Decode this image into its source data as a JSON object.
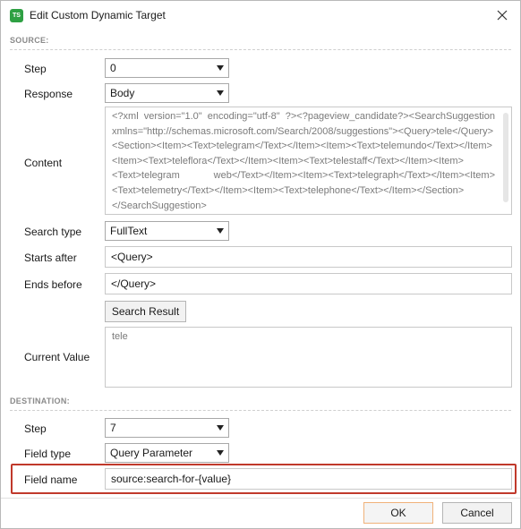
{
  "window": {
    "title": "Edit Custom Dynamic Target",
    "icon_text": "TS"
  },
  "source": {
    "section_label": "SOURCE:",
    "step": {
      "label": "Step",
      "value": "0"
    },
    "response": {
      "label": "Response",
      "value": "Body"
    },
    "content": {
      "label": "Content",
      "value": "<?xml version=\"1.0\" encoding=\"utf-8\" ?><?pageview_candidate?><SearchSuggestion xmlns=\"http://schemas.microsoft.com/Search/2008/suggestions\"><Query>tele</Query><Section><Item><Text>telegram</Text></Item><Item><Text>telemundo</Text></Item><Item><Text>teleflora</Text></Item><Item><Text>telestaff</Text></Item><Item><Text>telegram web</Text></Item><Item><Text>telegraph</Text></Item><Item><Text>telemetry</Text></Item><Item><Text>telephone</Text></Item></Section></SearchSuggestion>"
    },
    "search_type": {
      "label": "Search type",
      "value": "FullText"
    },
    "starts_after": {
      "label": "Starts after",
      "value": "<Query>"
    },
    "ends_before": {
      "label": "Ends before",
      "value": "</Query>"
    },
    "search_result_button": "Search Result",
    "current_value": {
      "label": "Current Value",
      "value": "tele"
    }
  },
  "destination": {
    "section_label": "DESTINATION:",
    "step": {
      "label": "Step",
      "value": "7"
    },
    "field_type": {
      "label": "Field type",
      "value": "Query Parameter"
    },
    "field_name": {
      "label": "Field name",
      "value": "source:search-for-{value}"
    }
  },
  "footer": {
    "ok_label": "OK",
    "cancel_label": "Cancel"
  },
  "colors": {
    "highlight_border": "#c0392b",
    "icon_bg": "#2ea043",
    "ok_border": "#f0b27a"
  }
}
